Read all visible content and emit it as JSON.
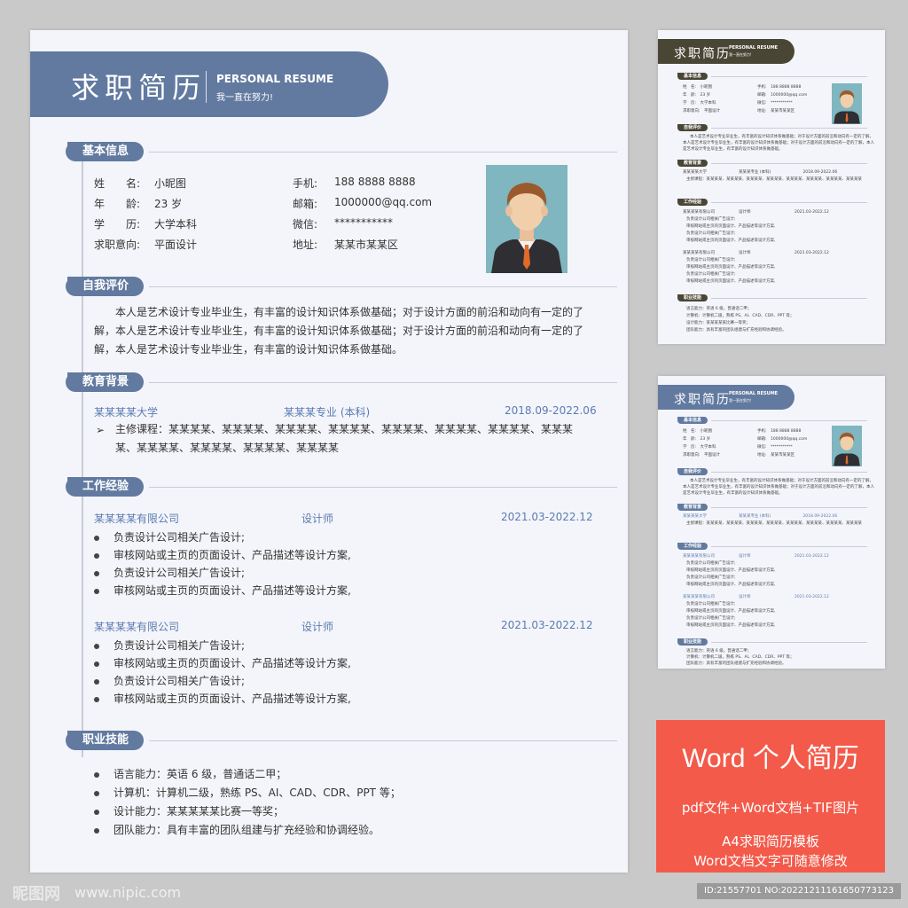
{
  "resume": {
    "title_cn": "求职简历",
    "title_en": "PERSONAL RESUME",
    "title_sub": "我一直在努力!",
    "sections": {
      "basic": "基本信息",
      "self": "自我评价",
      "edu": "教育背景",
      "work": "工作经验",
      "skills": "职业技能"
    },
    "basic_left": [
      {
        "label": "姓　　名:",
        "value": "小昵图"
      },
      {
        "label": "年　　龄:",
        "value": "23 岁"
      },
      {
        "label": "学　　历:",
        "value": "大学本科"
      },
      {
        "label": "求职意向:",
        "value": "平面设计"
      }
    ],
    "basic_right": [
      {
        "label": "手机:",
        "value": "188 8888 8888"
      },
      {
        "label": "邮箱:",
        "value": "1000000@qq.com"
      },
      {
        "label": "微信:",
        "value": "***********"
      },
      {
        "label": "地址:",
        "value": "某某市某某区"
      }
    ],
    "self_eval": "本人是艺术设计专业毕业生，有丰富的设计知识体系做基础；对于设计方面的前沿和动向有一定的了解，本人是艺术设计专业毕业生，有丰富的设计知识体系做基础；对于设计方面的前沿和动向有一定的了解，本人是艺术设计专业毕业生，有丰富的设计知识体系做基础。",
    "edu": {
      "school": "某某某某大学",
      "major": "某某某专业 (本科)",
      "date": "2018.09-2022.06",
      "courses": "主修课程：某某某某、某某某某、某某某某、某某某某、某某某某、某某某某、某某某某、某某某某、某某某某、某某某某、某某某某、某某某某"
    },
    "jobs": [
      {
        "company": "某某某某有限公司",
        "title": "设计师",
        "date": "2021.03-2022.12",
        "items": [
          "负责设计公司相关广告设计;",
          "审核网站或主页的页面设计、产品描述等设计方案,",
          "负责设计公司相关广告设计;",
          "审核网站或主页的页面设计、产品描述等设计方案,"
        ]
      },
      {
        "company": "某某某某有限公司",
        "title": "设计师",
        "date": "2021.03-2022.12",
        "items": [
          "负责设计公司相关广告设计;",
          "审核网站或主页的页面设计、产品描述等设计方案,",
          "负责设计公司相关广告设计;",
          "审核网站或主页的页面设计、产品描述等设计方案,"
        ]
      }
    ],
    "skills": [
      "语言能力：英语 6 级，普通话二甲；",
      "计算机：计算机二级，熟练 PS、AI、CAD、CDR、PPT 等；",
      "设计能力：某某某某某比赛一等奖；",
      "团队能力：具有丰富的团队组建与扩充经验和协调经验。"
    ]
  },
  "thumb": {
    "title_cn": "求职简历",
    "title_en": "PERSONAL RESUME",
    "title_sub": "我一直在努力!",
    "dark_color": "#4a4636",
    "blue_color": "#627aa0",
    "basic": [
      "姓　名:　小昵图",
      "年　龄:　23 岁",
      "学　历:　大学本科",
      "求职意向:　平面设计"
    ],
    "basic_r": [
      "手机:　188 8888 8888",
      "邮箱:　1000000@qq.com",
      "微信:　***********",
      "地址:　某某市某某区"
    ],
    "self": "本人是艺术设计专业毕业生，有丰富的设计知识体系做基础；对于设计方面的前沿和动向有一定的了解，",
    "self2": "本人是艺术设计专业毕业生，有丰富的设计知识体系做基础；对于设计方面的前沿和动向有一定的了解，本人",
    "self3": "是艺术设计专业毕业生，有丰富的设计知识体系做基础。",
    "edu_line": "某某某某大学　　　　　　　　某某某专业 (本科)　　　　　　　　2018.09-2022.06",
    "course": "主修课程：某某某某、某某某某、某某某某、某某某某、某某某某、某某某某、某某某某、某某某某",
    "job_line": "某某某某有限公司　　　　　　设计师　　　　　　　　　　　2021.03-2022.12",
    "job_a": "负责设计公司相关广告设计;",
    "job_b": "审核网站或主页的页面设计、产品描述等设计方案,",
    "skill1": "语言能力：英语 6 级，普通话二甲；",
    "skill2": "计算机：计算机二级，熟练 PS、AI、CAD、CDR、PPT 等；",
    "skill3": "设计能力：某某某某某比赛一等奖；",
    "skill4": "团队能力：具有丰富的团队组建与扩充经验和协调经验。"
  },
  "banner": {
    "title": "Word 个人简历",
    "line1": "pdf文件+Word文档+TIF图片",
    "line2": "A4求职简历模板",
    "line3": "Word文档文字可随意修改",
    "bg_color": "#f35a4a"
  },
  "footer": {
    "logo": "昵图网",
    "url": "www.nipic.com",
    "id": "ID:21557701 NO:20221211161650773123"
  }
}
